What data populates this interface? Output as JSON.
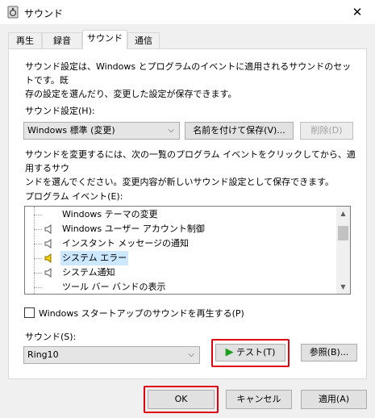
{
  "window": {
    "title": "サウンド",
    "close_glyph": "✕"
  },
  "tabs": [
    {
      "label": "再生"
    },
    {
      "label": "録音"
    },
    {
      "label": "サウンド"
    },
    {
      "label": "通信"
    }
  ],
  "intro_text_line1": "サウンド設定は、Windows とプログラムのイベントに適用されるサウンドのセットです。既",
  "intro_text_line2": "存の設定を選んだり、変更した設定が保存できます。",
  "scheme": {
    "label": "サウンド設定(H):",
    "value": "Windows 標準 (変更)",
    "save_as_label": "名前を付けて保存(V)...",
    "delete_label": "削除(D)"
  },
  "change_text_line1": "サウンドを変更するには、次の一覧のプログラム イベントをクリックしてから、適用するサウ",
  "change_text_line2": "ンドを選んでください。変更内容が新しいサウンド設定として保存できます。",
  "events": {
    "label": "プログラム イベント(E):",
    "items": [
      {
        "label": "Windows テーマの変更",
        "speaker": false
      },
      {
        "label": "Windows ユーザー アカウント制御",
        "speaker": true
      },
      {
        "label": "インスタント メッセージの通知",
        "speaker": true
      },
      {
        "label": "システム エラー",
        "speaker": true
      },
      {
        "label": "システム通知",
        "speaker": true
      },
      {
        "label": "ツール バー バンドの表示",
        "speaker": false
      }
    ],
    "selected": "システム エラー"
  },
  "startup_checkbox": {
    "label": "Windows スタートアップのサウンドを再生する(P)",
    "checked": false
  },
  "sound": {
    "label": "サウンド(S):",
    "value": "Ring10",
    "test_label": "テスト(T)",
    "browse_label": "参照(B)..."
  },
  "footer": {
    "ok_label": "OK",
    "cancel_label": "キャンセル",
    "apply_label": "適用(A)"
  },
  "colors": {
    "highlight_frame": "#e0000f",
    "selection": "#cce8ff",
    "play_icon": "#1e9e1e"
  }
}
